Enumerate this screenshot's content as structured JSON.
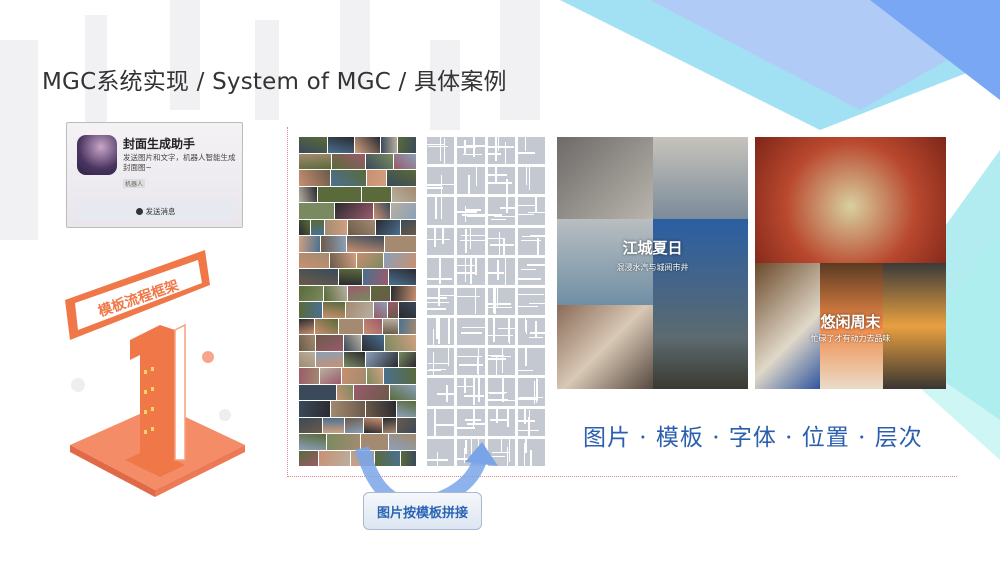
{
  "title": "MGC系统实现 / System of MGC / 具体案例",
  "card": {
    "name": "封面生成助手",
    "desc": "发送图片和文字，机器人智能生成封面图~",
    "tag": "机器人",
    "button": "发送消息"
  },
  "sign": {
    "label": "模板流程框架",
    "digit": "1"
  },
  "posters": [
    {
      "title": "江城夏日",
      "subtitle": "混浸水汽与城阅市井"
    },
    {
      "title": "悠闲周末",
      "subtitle": "忙碌了才有动力去品味"
    }
  ],
  "caption": "图片 · 模板 · 字体 · 位置 · 层次",
  "merge_button": "图片按模板拼接",
  "colors": {
    "accent": "#2b5fae",
    "orange": "#f07848"
  }
}
